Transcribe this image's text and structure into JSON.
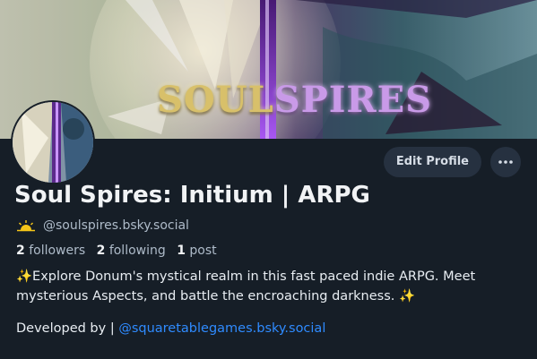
{
  "banner": {
    "title_part1": "SOUL",
    "title_part2": "SPIRES"
  },
  "profile": {
    "display_name": "Soul Spires: Initium | ARPG",
    "handle": "@soulspires.bsky.social",
    "handle_icon": "sunrise-emoji",
    "followers_count": "2",
    "followers_label": "followers",
    "following_count": "2",
    "following_label": "following",
    "posts_count": "1",
    "posts_label": "post",
    "bio_line1": "✨Explore Donum's mystical realm in this fast paced indie ARPG. Meet",
    "bio_line2": "mysterious Aspects, and battle the encroaching darkness. ✨",
    "developed_by_label": "Developed by",
    "developer_link": "@squaretablegames.bsky.social"
  },
  "actions": {
    "edit_profile_label": "Edit Profile",
    "more_icon": "ellipsis-icon"
  },
  "colors": {
    "background": "#161e27",
    "button_bg": "#263140",
    "link": "#2f8bff",
    "muted_text": "#aebbc9"
  }
}
